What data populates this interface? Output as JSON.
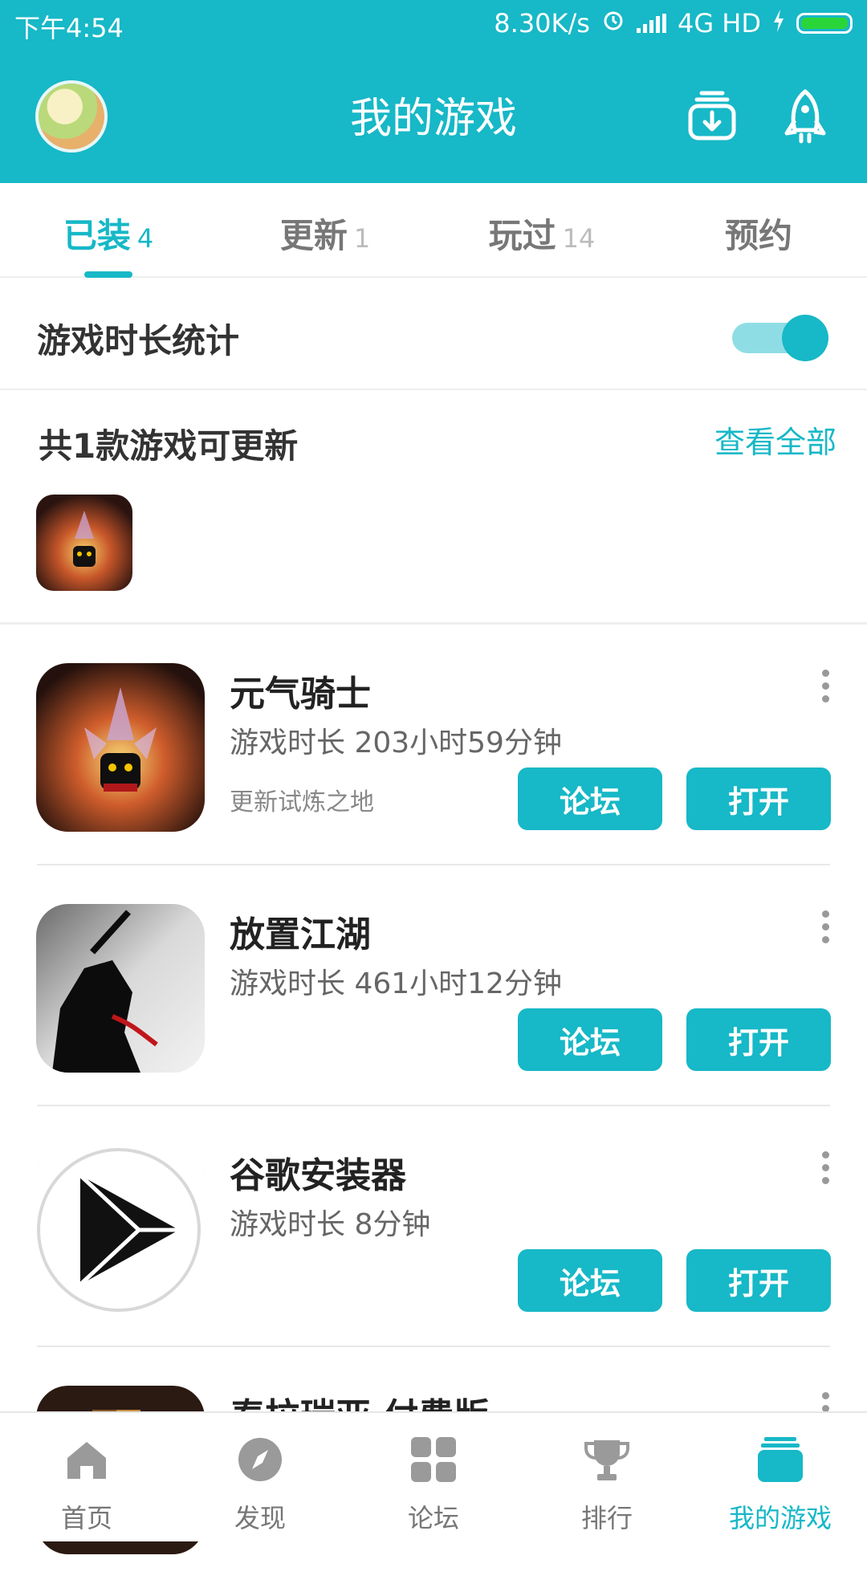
{
  "status_bar": {
    "time": "下午4:54",
    "speed": "8.30K/s",
    "network": "4G HD"
  },
  "header": {
    "title": "我的游戏",
    "icons": [
      "download-icon",
      "rocket-icon"
    ],
    "accent_color": "#17b8c7"
  },
  "tabs": [
    {
      "label": "已装",
      "count": "4",
      "active": true
    },
    {
      "label": "更新",
      "count": "1",
      "active": false
    },
    {
      "label": "玩过",
      "count": "14",
      "active": false
    },
    {
      "label": "预约",
      "count": "",
      "active": false
    }
  ],
  "playtime_toggle": {
    "label": "游戏时长统计",
    "enabled": true
  },
  "updates": {
    "title": "共1款游戏可更新",
    "view_all": "查看全部"
  },
  "games": [
    {
      "name": "元气骑士",
      "time": "游戏时长 203小时59分钟",
      "note": "更新试炼之地",
      "forum": "论坛",
      "open": "打开"
    },
    {
      "name": "放置江湖",
      "time": "游戏时长 461小时12分钟",
      "note": "",
      "forum": "论坛",
      "open": "打开"
    },
    {
      "name": "谷歌安装器",
      "time": "游戏时长 8分钟",
      "note": "",
      "forum": "论坛",
      "open": "打开"
    },
    {
      "name": "泰拉瑞亚 付费版",
      "time": "",
      "note": "",
      "forum": "",
      "open": ""
    }
  ],
  "bottom_nav": [
    {
      "label": "首页",
      "icon": "home-icon",
      "active": false
    },
    {
      "label": "发现",
      "icon": "compass-icon",
      "active": false
    },
    {
      "label": "论坛",
      "icon": "grid-icon",
      "active": false
    },
    {
      "label": "排行",
      "icon": "trophy-icon",
      "active": false
    },
    {
      "label": "我的游戏",
      "icon": "my-games-icon",
      "active": true
    }
  ]
}
